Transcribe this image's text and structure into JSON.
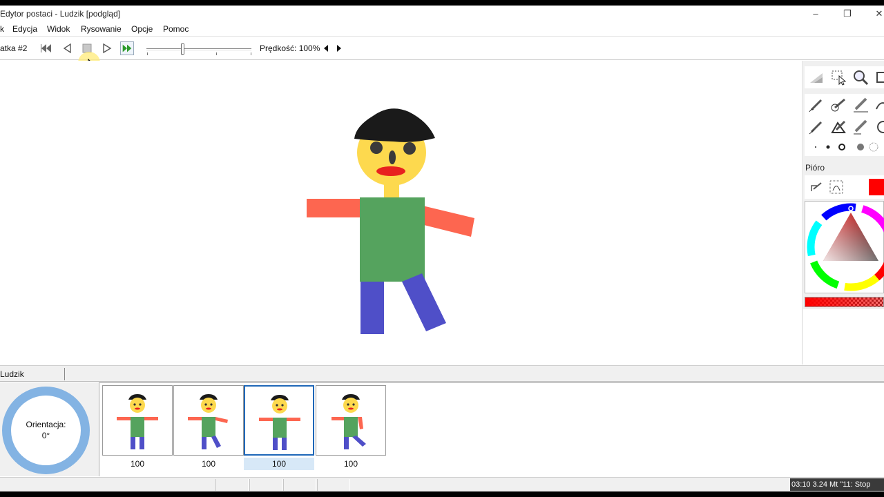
{
  "window": {
    "title": "Edytor postaci - Ludzik [podgląd]",
    "controls": [
      "minimize-icon",
      "restore-icon",
      "close-icon"
    ]
  },
  "menu": {
    "items": [
      "k",
      "Edycja",
      "Widok",
      "Rysowanie",
      "Opcje",
      "Pomoc"
    ]
  },
  "toolbar": {
    "frame_label": "atka #2",
    "buttons": [
      "rewind-start-icon",
      "step-back-icon",
      "stop-icon",
      "play-icon",
      "fast-forward-icon"
    ],
    "speed_label": "Prędkość: 100%",
    "slider_position_fraction": 0.33
  },
  "tools": {
    "pen_label": "Pióro",
    "current_color": "#ff0000"
  },
  "layer": {
    "name": "Ludzik"
  },
  "orientation": {
    "label": "Orientacja:",
    "value": "0°"
  },
  "frames": [
    {
      "duration": "100",
      "selected": false
    },
    {
      "duration": "100",
      "selected": false
    },
    {
      "duration": "100",
      "selected": true
    },
    {
      "duration": "100",
      "selected": false
    }
  ],
  "overlay": {
    "time_text": "03:10 3.24 Mt \"11: Stop"
  },
  "colors": {
    "hat": "#1a1a1a",
    "face": "#fdd94e",
    "mouth": "#e8211f",
    "arm": "#fd6650",
    "torso": "#55a35e",
    "leg": "#4f4fc8",
    "selection": "#1e67b8",
    "orientation_ring": "#83b3e3"
  }
}
